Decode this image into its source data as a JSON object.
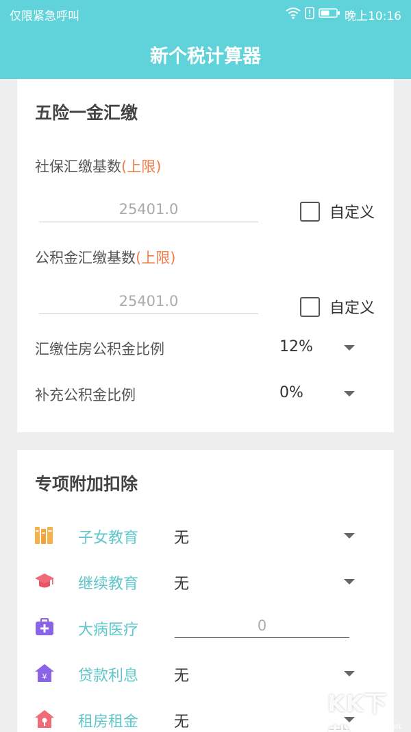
{
  "status_bar": {
    "left_text": "仅限紧急呼叫",
    "time": "晚上10:16"
  },
  "app": {
    "title": "新个税计算器"
  },
  "insurance": {
    "title": "五险一金汇缴",
    "social_base": {
      "label": "社保汇缴基数",
      "label_highlight": "(上限)",
      "placeholder": "25401.0",
      "checkbox_label": "自定义"
    },
    "fund_base": {
      "label": "公积金汇缴基数",
      "label_highlight": "(上限)",
      "placeholder": "25401.0",
      "checkbox_label": "自定义"
    },
    "fund_ratio": {
      "label": "汇缴住房公积金比例",
      "value": "12%"
    },
    "supp_ratio": {
      "label": "补充公积金比例",
      "value": "0%"
    }
  },
  "deductions": {
    "title": "专项附加扣除",
    "items": [
      {
        "label": "子女教育",
        "value": "无",
        "icon": "books-icon",
        "color": "#f5b24a"
      },
      {
        "label": "继续教育",
        "value": "无",
        "icon": "graduation-cap-icon",
        "color": "#f06b77"
      },
      {
        "label": "大病医疗",
        "placeholder": "0",
        "icon": "medical-kit-icon",
        "color": "#8a63e6"
      },
      {
        "label": "贷款利息",
        "value": "无",
        "icon": "house-yen-icon",
        "color": "#8a63e6"
      },
      {
        "label": "租房租金",
        "value": "无",
        "icon": "house-key-icon",
        "color": "#f06b77"
      }
    ]
  },
  "watermark": {
    "logo": "KK下载",
    "url": "www.kkx.net"
  },
  "colors": {
    "primary": "#5fd3d9",
    "accent": "#f07c4a",
    "label_teal": "#5fc6cc"
  }
}
